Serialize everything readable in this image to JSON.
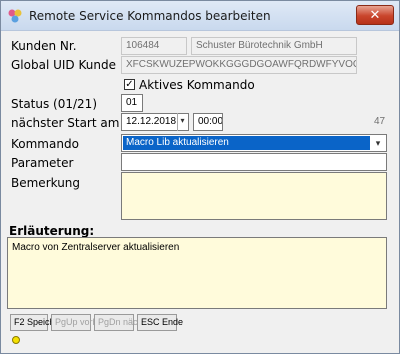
{
  "window": {
    "title": "Remote Service Kommandos bearbeiten",
    "close_label": "✕"
  },
  "form": {
    "kunden_nr_label": "Kunden Nr.",
    "kunden_nr_value": "106484",
    "kunden_name_value": "Schuster Bürotechnik GmbH",
    "uid_label": "Global UID Kunde",
    "uid_value": "XFCSKWUZEPWOKKGGGDGOAWFQRDWFYVOO",
    "aktiv_label": "Aktives Kommando",
    "aktiv_checked": "✓",
    "status_label": "Status (01/21)",
    "status_value": "01",
    "naechster_label": "nächster Start am",
    "date_value": "12.12.2018",
    "time_value": "00:00",
    "count_value": "47",
    "kommando_label": "Kommando",
    "kommando_value": "Macro Lib aktualisieren",
    "parameter_label": "Parameter",
    "parameter_value": "",
    "bemerkung_label": "Bemerkung",
    "bemerkung_value": ""
  },
  "erlaeuterung": {
    "label": "Erläuterung:",
    "text": "Macro von Zentralserver aktualisieren"
  },
  "buttons": {
    "save": "F2 Speich.",
    "pgup": "PgUp vorh",
    "pgdn": "PgDn näch",
    "esc": "ESC Ende"
  },
  "icons": {
    "app": "app-icon",
    "close": "close-icon",
    "status_led": "status-led-icon"
  },
  "colors": {
    "selection": "#0a64c8",
    "memo_background": "#fffbdb",
    "status_led": "#f4e000"
  }
}
